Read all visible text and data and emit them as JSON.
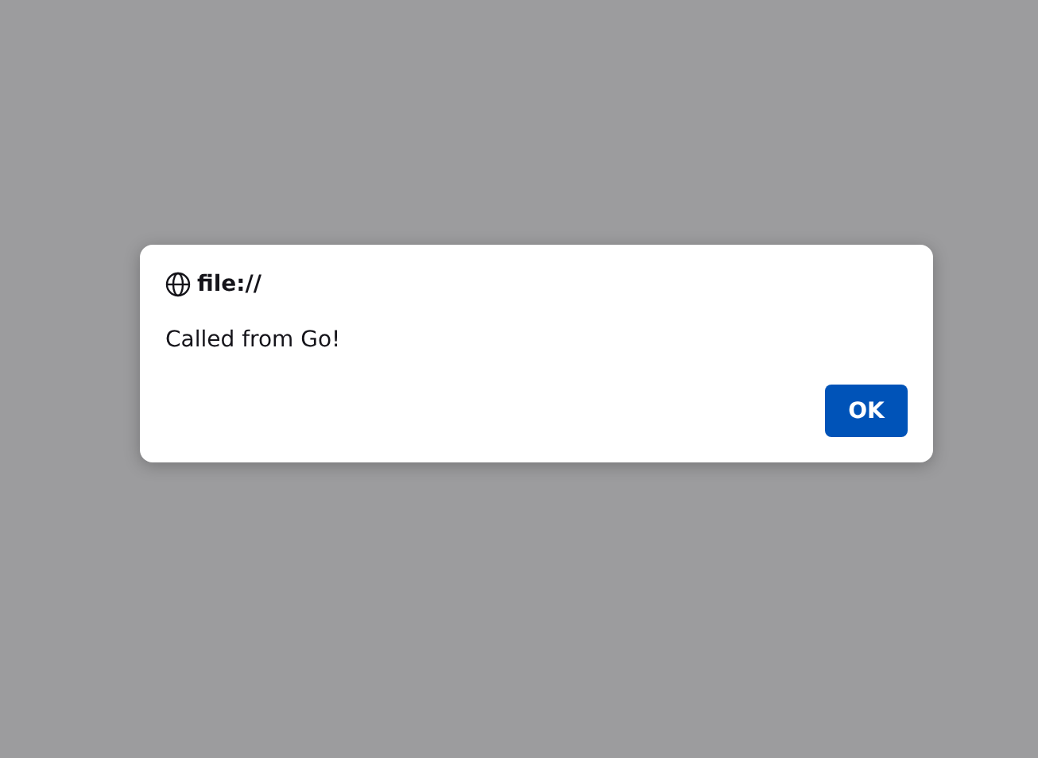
{
  "dialog": {
    "origin": "file://",
    "message": "Called from Go!",
    "buttons": [
      "OK"
    ]
  }
}
